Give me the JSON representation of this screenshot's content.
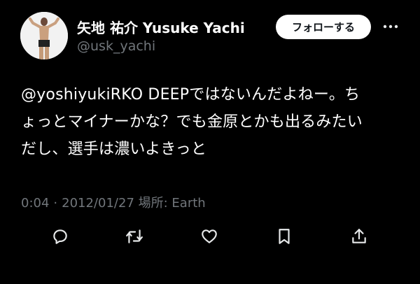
{
  "user": {
    "display_name": "矢地 祐介 Yusuke Yachi",
    "handle": "@usk_yachi",
    "avatar_icon": "profile-photo-fighter"
  },
  "follow_button": {
    "label": "フォローする"
  },
  "more_icon": "more-horizontal-icon",
  "tweet": {
    "lines": [
      "@yoshiyukiRKO DEEPではないんだよねー。ち",
      "ょっとマイナーかな？でも金原とかも出るみたい",
      "だし、選手は濃いよきっと"
    ]
  },
  "meta": {
    "time": "0:04",
    "separator": "·",
    "date": "2012/01/27",
    "location_label": "場所: Earth"
  },
  "actions": [
    {
      "name": "reply",
      "icon": "reply-icon"
    },
    {
      "name": "retweet",
      "icon": "retweet-icon"
    },
    {
      "name": "like",
      "icon": "like-icon"
    },
    {
      "name": "bookmark",
      "icon": "bookmark-icon"
    },
    {
      "name": "share",
      "icon": "share-icon"
    }
  ],
  "colors": {
    "background": "#000000",
    "text": "#ffffff",
    "secondary_text": "#71767b",
    "button_bg": "#ffffff",
    "button_text": "#0f1419",
    "icon": "#e7e9ea"
  }
}
